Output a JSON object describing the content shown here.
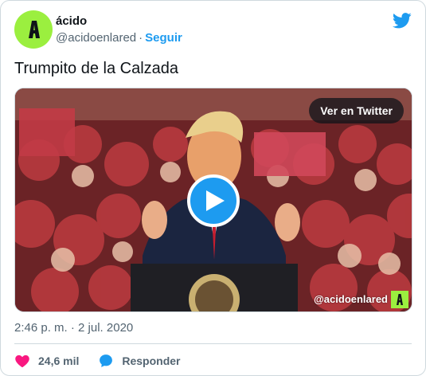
{
  "author": {
    "display_name": "ácido",
    "handle": "@acidoenlared",
    "separator": "·",
    "follow_label": "Seguir",
    "avatar_color": "#9bef3f",
    "avatar_icon": "acido-logo"
  },
  "platform_icon": "twitter-bird-icon",
  "tweet": {
    "text": "Trumpito de la Calzada"
  },
  "media": {
    "watch_label": "Ver en Twitter",
    "watermark": "@acidoenlared",
    "play_icon": "play-icon"
  },
  "meta": {
    "timestamp": "2:46 p. m. · 2 jul. 2020"
  },
  "actions": {
    "likes": "24,6 mil",
    "reply_label": "Responder"
  },
  "colors": {
    "accent": "#1d9bf0",
    "like": "#f91880",
    "secondary_text": "#536471",
    "border": "#cfd9de"
  }
}
